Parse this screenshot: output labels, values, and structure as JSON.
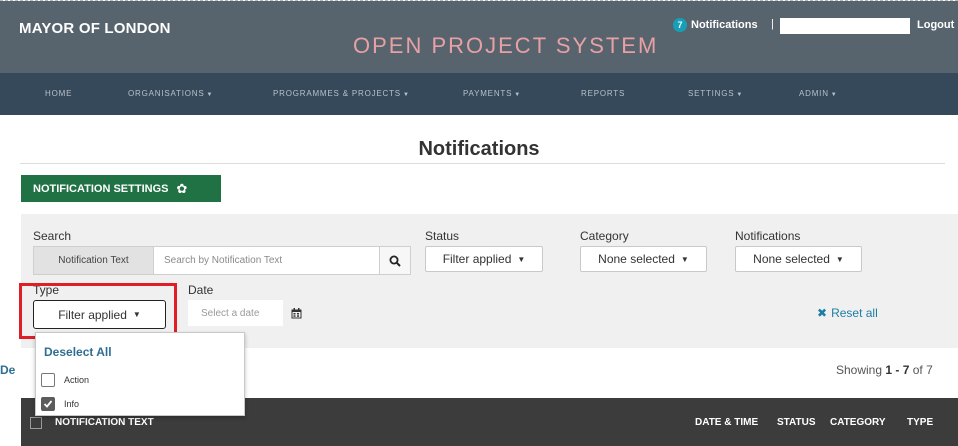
{
  "header": {
    "brand": "MAYOR OF LONDON",
    "system_title": "OPEN PROJECT SYSTEM",
    "notifications_count": "7",
    "notifications_label": "Notifications",
    "separator": "|",
    "logout": "Logout"
  },
  "nav": {
    "items": [
      {
        "label": "HOME",
        "has_caret": false
      },
      {
        "label": "ORGANISATIONS",
        "has_caret": true
      },
      {
        "label": "PROGRAMMES & PROJECTS",
        "has_caret": true
      },
      {
        "label": "PAYMENTS",
        "has_caret": true
      },
      {
        "label": "REPORTS",
        "has_caret": false
      },
      {
        "label": "SETTINGS",
        "has_caret": true
      },
      {
        "label": "ADMIN",
        "has_caret": true
      }
    ]
  },
  "page": {
    "title": "Notifications",
    "settings_button": "NOTIFICATION SETTINGS"
  },
  "filters": {
    "search_label": "Search",
    "search_addon": "Notification Text",
    "search_placeholder": "Search by Notification Text",
    "status_label": "Status",
    "status_value": "Filter applied",
    "category_label": "Category",
    "category_value": "None selected",
    "notifications_label": "Notifications",
    "notifications_value": "None selected",
    "type_label": "Type",
    "type_value": "Filter applied",
    "date_label": "Date",
    "date_placeholder": "Select a date",
    "reset_all": "Reset all"
  },
  "type_menu": {
    "deselect_all": "Deselect All",
    "options": [
      {
        "label": "Action",
        "checked": false
      },
      {
        "label": "Info",
        "checked": true
      }
    ]
  },
  "results": {
    "left_truncated": "De",
    "showing_prefix": "Showing ",
    "range": "1 - 7",
    "of_text": " of ",
    "total": "7"
  },
  "table": {
    "headers": [
      "NOTIFICATION TEXT",
      "DATE & TIME",
      "STATUS",
      "CATEGORY",
      "TYPE"
    ]
  },
  "colors": {
    "header_bg": "#58646d",
    "nav_bg": "#36495a",
    "title_pink": "#e7a0a4",
    "settings_green": "#207244",
    "link_blue": "#2f6e94",
    "highlight_red": "#e01e26",
    "table_head_bg": "#3c3c3c"
  }
}
